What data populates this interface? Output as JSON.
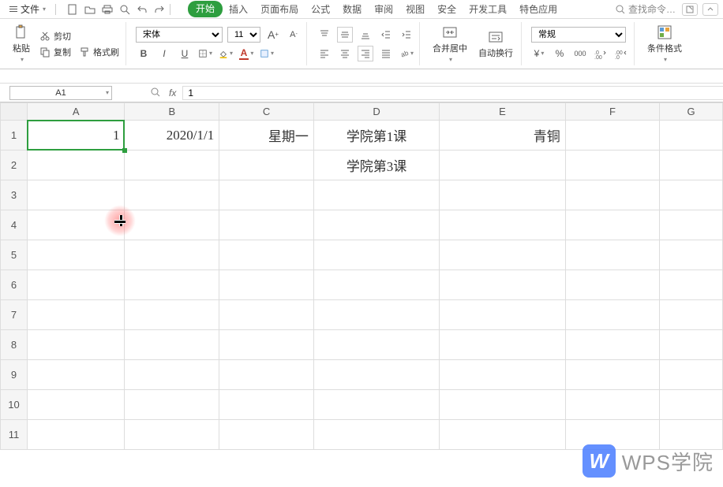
{
  "menubar": {
    "file": "文件",
    "tabs": [
      "开始",
      "插入",
      "页面布局",
      "公式",
      "数据",
      "审阅",
      "视图",
      "安全",
      "开发工具",
      "特色应用"
    ],
    "active_tab_index": 0,
    "search_placeholder": "查找命令…"
  },
  "ribbon": {
    "clipboard": {
      "paste": "粘贴",
      "cut": "剪切",
      "copy": "复制",
      "format_painter": "格式刷"
    },
    "font": {
      "name": "宋体",
      "size": "11",
      "bold": "B",
      "italic": "I",
      "underline": "U"
    },
    "alignment": {
      "merge_center": "合并居中",
      "wrap_text": "自动换行"
    },
    "number": {
      "format": "常规"
    },
    "styles": {
      "conditional": "条件格式"
    }
  },
  "formula_bar": {
    "cell_ref": "A1",
    "fx": "fx",
    "value": "1"
  },
  "grid": {
    "columns": [
      "A",
      "B",
      "C",
      "D",
      "E",
      "F",
      "G"
    ],
    "rows": [
      "1",
      "2",
      "3",
      "4",
      "5",
      "6",
      "7",
      "8",
      "9",
      "10",
      "11"
    ],
    "cells": {
      "A1": "1",
      "B1": "2020/1/1",
      "C1": "星期一",
      "D1": "学院第1课",
      "E1": "青铜",
      "D2": "学院第3课"
    }
  },
  "watermark": {
    "logo": "W",
    "text": "WPS学院"
  }
}
